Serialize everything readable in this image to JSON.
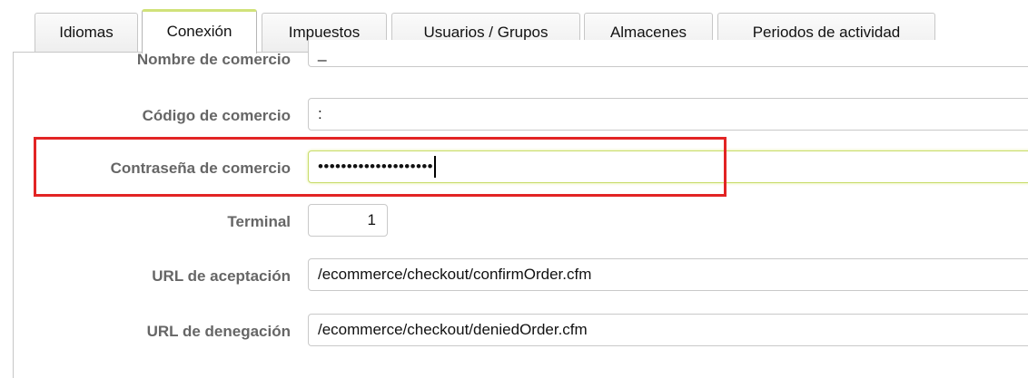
{
  "tabs": [
    {
      "label": "Idiomas",
      "active": false
    },
    {
      "label": "Conexión",
      "active": true
    },
    {
      "label": "Impuestos",
      "active": false
    },
    {
      "label": "Usuarios / Grupos",
      "active": false
    },
    {
      "label": "Almacenes",
      "active": false
    },
    {
      "label": "Periodos de actividad",
      "active": false
    }
  ],
  "form": {
    "merchant_name": {
      "label": "Nombre de comercio",
      "value": "_"
    },
    "merchant_code": {
      "label": "Código de comercio",
      "value": ":"
    },
    "merchant_password": {
      "label": "Contraseña de comercio",
      "value": "••••••••••••••••••••"
    },
    "terminal": {
      "label": "Terminal",
      "value": "1"
    },
    "accept_url": {
      "label": "URL de aceptación",
      "value": "/ecommerce/checkout/confirmOrder.cfm"
    },
    "deny_url": {
      "label": "URL de denegación",
      "value": "/ecommerce/checkout/deniedOrder.cfm"
    }
  },
  "colors": {
    "highlight": "#e22424",
    "active_tab_accent": "#d0e27a",
    "label_text": "#666666"
  }
}
